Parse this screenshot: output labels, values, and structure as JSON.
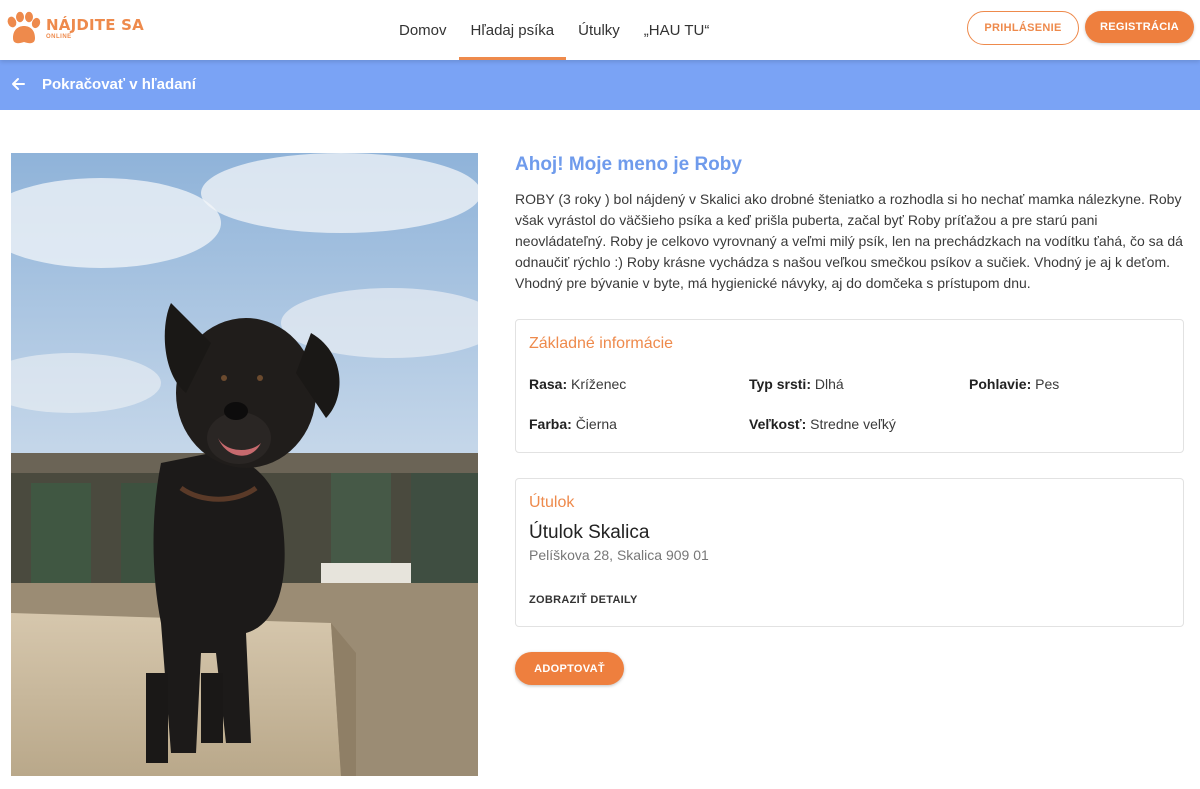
{
  "logo": {
    "title": "NÁJDITE SA",
    "subtitle": "ONLINE",
    "icon": "paw-icon"
  },
  "nav": {
    "items": [
      {
        "label": "Domov",
        "active": false
      },
      {
        "label": "Hľadaj psíka",
        "active": true
      },
      {
        "label": "Útulky",
        "active": false
      },
      {
        "label": "„HAU TU“",
        "active": false
      }
    ]
  },
  "auth": {
    "login_label": "PRIHLÁSENIE",
    "register_label": "REGISTRÁCIA"
  },
  "backbar": {
    "label": "Pokračovať v hľadaní",
    "icon": "arrow-left-icon"
  },
  "photo": {
    "icon": "dog-photo",
    "alt": "Roby"
  },
  "dog": {
    "title": "Ahoj! Moje meno je Roby",
    "description": "ROBY (3 roky ) bol nájdený v Skalici ako drobné šteniatko a rozhodla si ho nechať mamka nálezkyne. Roby však vyrástol do väčšieho psíka a keď prišla puberta, začal byť Roby príťažou a pre starú pani neovládateľný. Roby je celkovo vyrovnaný a veľmi milý psík, len na prechádzkach na vodítku ťahá, čo sa dá odnaučiť rýchlo :) Roby krásne vychádza s našou veľkou smečkou psíkov a sučiek. Vhodný je aj k deťom. Vhodný pre bývanie v byte, má hygienické návyky, aj do domčeka s prístupom dnu."
  },
  "basic_info": {
    "heading": "Základné informácie",
    "breed": {
      "label": "Rasa:",
      "value": "Kríženec"
    },
    "coat": {
      "label": "Typ srsti:",
      "value": "Dlhá"
    },
    "sex": {
      "label": "Pohlavie:",
      "value": "Pes"
    },
    "color": {
      "label": "Farba:",
      "value": "Čierna"
    },
    "size": {
      "label": "Veľkosť:",
      "value": "Stredne veľký"
    }
  },
  "shelter": {
    "heading": "Útulok",
    "name": "Útulok Skalica",
    "address": "Pelíškova 28, Skalica 909 01",
    "details_label": "ZOBRAZIŤ DETAILY"
  },
  "adopt_label": "ADOPTOVAŤ",
  "colors": {
    "accent": "#ee7f3e",
    "title_blue": "#6f9bec",
    "backbar": "#7aa3f5"
  }
}
